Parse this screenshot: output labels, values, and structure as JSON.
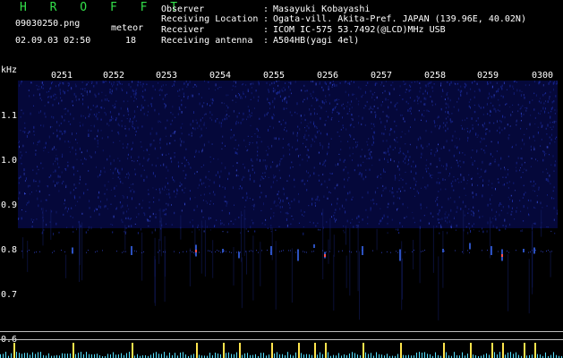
{
  "header": {
    "app_title": "H R O F F T",
    "filename": "09030250.png",
    "datetime": "02.09.03 02:50",
    "meteor_label": "meteor",
    "meteor_count": "18",
    "info": [
      {
        "label": "Observer",
        "sep": ":",
        "value": "Masayuki Kobayashi"
      },
      {
        "label": "Receiving Location",
        "sep": ":",
        "value": "Ogata-vill. Akita-Pref. JAPAN (139.96E, 40.02N)"
      },
      {
        "label": "Receiver",
        "sep": ":",
        "value": "ICOM IC-575 53.7492(@LCD)MHz USB"
      },
      {
        "label": "Receiving antenna",
        "sep": ":",
        "value": "A504HB(yagi 4el)"
      }
    ]
  },
  "axis": {
    "y_unit": "kHz",
    "y_ticks": [
      {
        "label": "1.1",
        "value": 1.1
      },
      {
        "label": "1.0",
        "value": 1.0
      },
      {
        "label": "0.9",
        "value": 0.9
      },
      {
        "label": "0.8",
        "value": 0.8
      },
      {
        "label": "0.7",
        "value": 0.7
      },
      {
        "label": "0.6",
        "value": 0.6
      }
    ],
    "x_ticks": [
      "0251",
      "0252",
      "0253",
      "0254",
      "0255",
      "0256",
      "0257",
      "0258",
      "0259",
      "0300"
    ]
  },
  "colors": {
    "title": "#33e04a",
    "text": "#ffffff",
    "noise": "#1a2a9a",
    "echo": "#3a6cff",
    "echo_hot": "#ff5050",
    "amplitude": "#55e0ff",
    "amplitude_peak": "#ffe44d",
    "reference_line": "#bdbdbd"
  },
  "meteor_echoes": [
    {
      "time": "0250.2",
      "freq_khz": 0.8
    },
    {
      "time": "0251.3",
      "freq_khz": 0.8
    },
    {
      "time": "0252.4",
      "freq_khz": 0.8
    },
    {
      "time": "0253.6",
      "freq_khz": 0.8
    },
    {
      "time": "0254.1",
      "freq_khz": 0.8
    },
    {
      "time": "0254.4",
      "freq_khz": 0.79
    },
    {
      "time": "0255.0",
      "freq_khz": 0.8
    },
    {
      "time": "0255.5",
      "freq_khz": 0.79
    },
    {
      "time": "0255.8",
      "freq_khz": 0.81
    },
    {
      "time": "0256.0",
      "freq_khz": 0.79
    },
    {
      "time": "0256.7",
      "freq_khz": 0.8
    },
    {
      "time": "0257.4",
      "freq_khz": 0.79
    },
    {
      "time": "0258.2",
      "freq_khz": 0.8
    },
    {
      "time": "0258.7",
      "freq_khz": 0.81
    },
    {
      "time": "0259.1",
      "freq_khz": 0.8
    },
    {
      "time": "0259.3",
      "freq_khz": 0.79
    },
    {
      "time": "0259.7",
      "freq_khz": 0.8
    },
    {
      "time": "0259.9",
      "freq_khz": 0.8
    }
  ]
}
